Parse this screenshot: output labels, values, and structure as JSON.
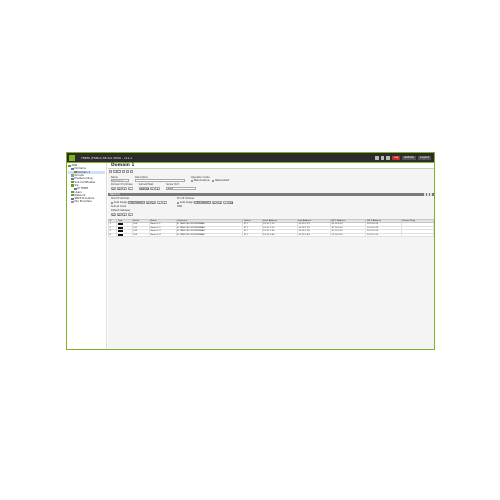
{
  "app": {
    "title": "TMMS (FSRCA-SE-Sol-3000 - v11.x",
    "actions": {
      "log": "Log",
      "refresh": "Refresh",
      "logout": "Logout"
    }
  },
  "sidebar": {
    "items": [
      {
        "label": "ADN",
        "indent": 0,
        "icon": "server-icon",
        "selected": false
      },
      {
        "label": "Domains",
        "indent": 1,
        "icon": "folder-icon",
        "selected": false
      },
      {
        "label": "Domain 1",
        "indent": 2,
        "icon": "domain-icon",
        "selected": true
      },
      {
        "label": "Groups",
        "indent": 1,
        "icon": "group-icon",
        "selected": false
      },
      {
        "label": "Pre-Recording",
        "indent": 1,
        "icon": "recording-icon",
        "selected": false
      },
      {
        "label": "Sub Certificates",
        "indent": 1,
        "icon": "certificate-icon",
        "selected": false
      },
      {
        "label": "Sip",
        "indent": 1,
        "icon": "sip-icon",
        "selected": false
      },
      {
        "label": "IP TERM",
        "indent": 2,
        "icon": "terminal-icon",
        "selected": false
      },
      {
        "label": "Users",
        "indent": 1,
        "icon": "users-icon",
        "selected": false
      },
      {
        "label": "Network",
        "indent": 1,
        "icon": "network-icon",
        "selected": false
      },
      {
        "label": "SBCS Providers",
        "indent": 1,
        "icon": "provider-icon",
        "selected": false
      },
      {
        "label": "Fax Providers",
        "indent": 1,
        "icon": "fax-icon",
        "selected": false
      }
    ]
  },
  "main": {
    "title": "Domain 1",
    "form": {
      "name_label": "Name",
      "name_value": "Domain 1",
      "description_label": "Description",
      "mode_label": "Operation mode",
      "mode_options": [
        "Stand-alone",
        "Redundant"
      ],
      "ip_label": "Domain IP Address",
      "ip_octets": [
        "10",
        "10",
        "0",
        "1"
      ],
      "mask_label": "Subnet Mask",
      "mask_octets": [
        "255",
        "255",
        "0",
        "0"
      ],
      "port_label": "Server Port",
      "port_value": "8080"
    },
    "section": {
      "title": "Network"
    },
    "ipform": {
      "first_label": "Start IP Address",
      "last_label": "End IP Address",
      "auto_label": "Auto Assign",
      "get_label": "Get Current",
      "start_octets": [
        "10",
        "10",
        "1",
        "1"
      ],
      "end_octets": [
        "10",
        "10",
        "1",
        "254"
      ],
      "subnet_label": "Subnet mask",
      "gateway_label": "Default Gateway",
      "dns_label": "DNS",
      "gw_octets": [
        "10",
        "10",
        "0",
        "1"
      ]
    },
    "table": {
      "headers": [
        "#",
        "Type",
        "Prefix",
        "Name",
        "Comment",
        "Status",
        "Start Address",
        "End Address",
        "SIP 1 Address",
        "SIP 2 Address",
        "Master Ring"
      ],
      "rows": [
        [
          "1",
          "",
          "100",
          "Room 1-1",
          "IP TERM (ROOM-TERMINAL)",
          "IP 1",
          "10.10.1.10",
          "10.10.1.19",
          "10.10.0.10",
          "10.10.0.20",
          ""
        ],
        [
          "2",
          "",
          "101",
          "Room 1-2",
          "IP TERM (ROOM-TERMINAL)",
          "IP 1",
          "10.10.1.20",
          "10.10.1.29",
          "10.10.0.10",
          "10.10.0.20",
          ""
        ],
        [
          "3",
          "",
          "102",
          "Room 1-3",
          "IP TERM (ROOM-TERMINAL)",
          "IP 1",
          "10.10.1.30",
          "10.10.1.39",
          "10.10.0.10",
          "10.10.0.20",
          ""
        ],
        [
          "4",
          "",
          "103",
          "Room 1-4",
          "IP TERM (ROOM-TERMINAL)",
          "IP 1",
          "10.10.1.40",
          "10.10.1.49",
          "10.10.0.10",
          "10.10.0.20",
          ""
        ]
      ]
    }
  },
  "colors": {
    "accent": "#7fb027",
    "titlebar": "#2c2c2c",
    "danger": "#c62828"
  }
}
